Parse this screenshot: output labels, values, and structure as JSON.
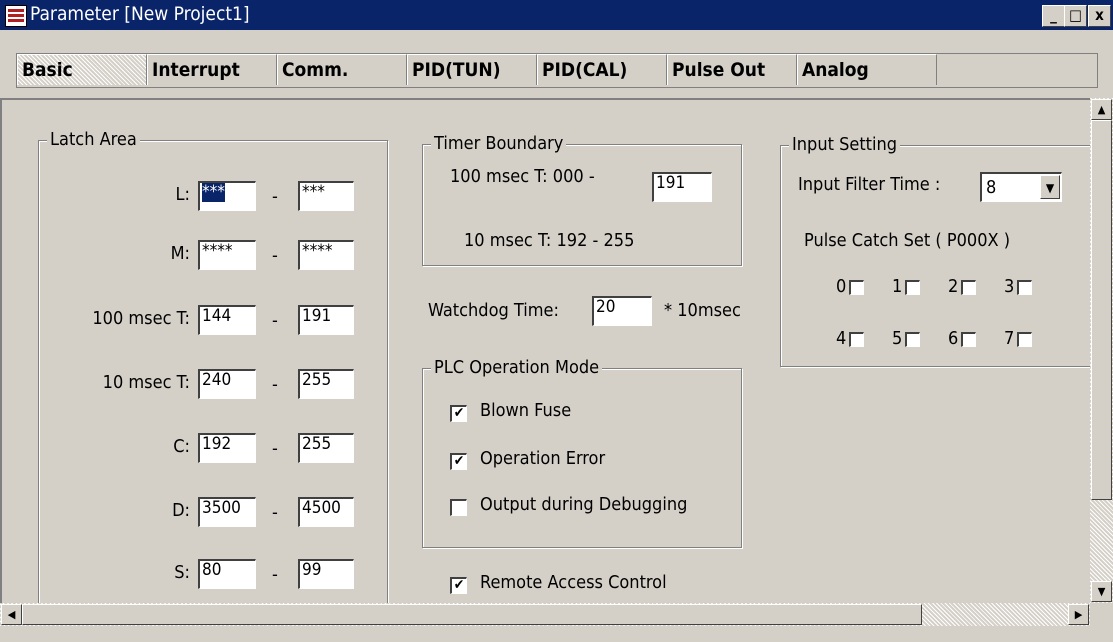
{
  "window": {
    "title": "Parameter [New Project1]",
    "minimize": "_",
    "maximize": "□",
    "close": "x"
  },
  "tabs": [
    {
      "label": "Basic"
    },
    {
      "label": "Interrupt"
    },
    {
      "label": "Comm."
    },
    {
      "label": "PID(TUN)"
    },
    {
      "label": "PID(CAL)"
    },
    {
      "label": "Pulse Out"
    },
    {
      "label": "Analog"
    }
  ],
  "latch": {
    "title": "Latch Area",
    "rows": [
      {
        "label": "L:",
        "from": "***",
        "to": "***",
        "dash": "-"
      },
      {
        "label": "M:",
        "from": "****",
        "to": "****",
        "dash": "-"
      },
      {
        "label": "100 msec T:",
        "from": "144",
        "to": "191",
        "dash": "-"
      },
      {
        "label": "10 msec T:",
        "from": "240",
        "to": "255",
        "dash": "-"
      },
      {
        "label": "C:",
        "from": "192",
        "to": "255",
        "dash": "-"
      },
      {
        "label": "D:",
        "from": "3500",
        "to": "4500",
        "dash": "-"
      },
      {
        "label": "S:",
        "from": "80",
        "to": "99",
        "dash": "-"
      }
    ]
  },
  "timer": {
    "title": "Timer Boundary",
    "row1_label": "100 msec T:  000  -",
    "row1_value": "191",
    "row2_label": "10 msec T:  192  -   255"
  },
  "watchdog": {
    "label": "Watchdog Time:",
    "value": "20",
    "unit": "* 10msec"
  },
  "plc_mode": {
    "title": "PLC Operation Mode",
    "options": [
      {
        "label": "Blown Fuse",
        "checked": true
      },
      {
        "label": "Operation Error",
        "checked": true
      },
      {
        "label": "Output during Debugging",
        "checked": false
      }
    ]
  },
  "remote": {
    "label": "Remote Access Control",
    "checked": true
  },
  "input": {
    "title": "Input Setting",
    "filter_label": "Input Filter Time :",
    "filter_value": "8",
    "pulse_label": "Pulse Catch Set ( P000X )",
    "bits": [
      "0",
      "1",
      "2",
      "3",
      "4",
      "5",
      "6",
      "7"
    ]
  },
  "colors": {
    "titlebar": "#0a246a",
    "face": "#d4d0c8"
  }
}
